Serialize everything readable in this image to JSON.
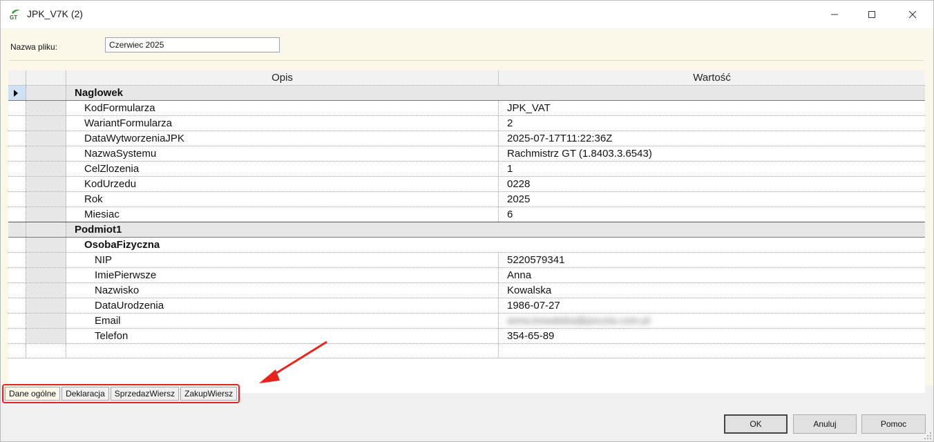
{
  "window": {
    "title": "JPK_V7K (2)",
    "app_icon": "gt-app-icon",
    "controls": [
      "minimize-icon",
      "maximize-icon",
      "close-icon"
    ]
  },
  "form": {
    "file_label": "Nazwa pliku:",
    "file_value": "Czerwiec 2025"
  },
  "grid": {
    "columns": [
      "Opis",
      "Wartość"
    ],
    "rows": {
      "naglowek": "Naglowek",
      "kod_formularza": {
        "label": "KodFormularza",
        "value": "JPK_VAT"
      },
      "wariant": {
        "label": "WariantFormularza",
        "value": "2"
      },
      "data_wytw": {
        "label": "DataWytworzeniaJPK",
        "value": "2025-07-17T11:22:36Z"
      },
      "nazwa_systemu": {
        "label": "NazwaSystemu",
        "value": "Rachmistrz GT (1.8403.3.6543)"
      },
      "cel_zlozenia": {
        "label": "CelZlozenia",
        "value": "1"
      },
      "kod_urzedu": {
        "label": "KodUrzedu",
        "value": "0228"
      },
      "rok": {
        "label": "Rok",
        "value": "2025"
      },
      "miesiac": {
        "label": "Miesiac",
        "value": "6"
      },
      "podmiot": "Podmiot1",
      "osoba": "OsobaFizyczna",
      "nip": {
        "label": "NIP",
        "value": "5220579341"
      },
      "imie": {
        "label": "ImiePierwsze",
        "value": "Anna"
      },
      "nazwisko": {
        "label": "Nazwisko",
        "value": "Kowalska"
      },
      "data_urodzenia": {
        "label": "DataUrodzenia",
        "value": "1986-07-27"
      },
      "email": {
        "label": "Email",
        "value": "anna.kowalska@poczta.com.pl"
      },
      "telefon": {
        "label": "Telefon",
        "value": "354-65-89"
      }
    }
  },
  "tabs": [
    "Dane ogólne",
    "Deklaracja",
    "SprzedazWiersz",
    "ZakupWiersz"
  ],
  "active_tab": "Dane ogólne",
  "buttons": {
    "ok": "OK",
    "anuluj": "Anuluj",
    "pomoc": "Pomoc"
  },
  "colors": {
    "highlight": "#e8231b",
    "panel": "#fbf7e9",
    "group_row": "#e7e7e7"
  }
}
